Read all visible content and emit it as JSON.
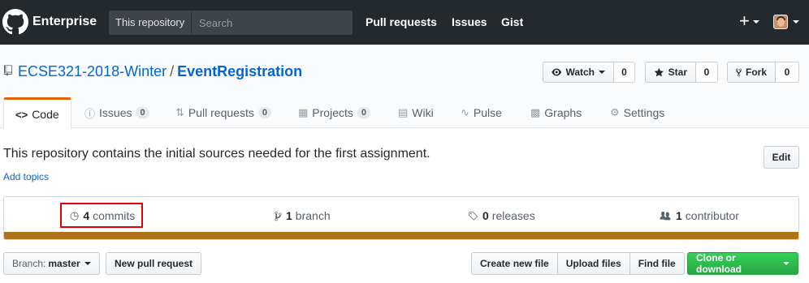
{
  "header": {
    "brand": "Enterprise",
    "search_scope": "This repository",
    "search_placeholder": "Search",
    "nav": [
      "Pull requests",
      "Issues",
      "Gist"
    ],
    "plus_label": "+"
  },
  "repo": {
    "owner": "ECSE321-2018-Winter",
    "separator": "/",
    "name": "EventRegistration",
    "watch_label": "Watch",
    "watch_count": "0",
    "star_label": "Star",
    "star_count": "0",
    "fork_label": "Fork",
    "fork_count": "0"
  },
  "tabs": [
    {
      "label": "Code",
      "icon": "code-icon"
    },
    {
      "label": "Issues",
      "counter": "0",
      "icon": "issue-icon"
    },
    {
      "label": "Pull requests",
      "counter": "0",
      "icon": "pull-request-icon"
    },
    {
      "label": "Projects",
      "counter": "0",
      "icon": "project-icon"
    },
    {
      "label": "Wiki",
      "icon": "book-icon"
    },
    {
      "label": "Pulse",
      "icon": "pulse-icon"
    },
    {
      "label": "Graphs",
      "icon": "graph-icon"
    },
    {
      "label": "Settings",
      "icon": "gear-icon"
    }
  ],
  "description": "This repository contains the initial sources needed for the first assignment.",
  "add_topics": "Add topics",
  "edit_label": "Edit",
  "summary": {
    "commits_count": "4",
    "commits_label": "commits",
    "branch_count": "1",
    "branch_label": "branch",
    "releases_count": "0",
    "releases_label": "releases",
    "contributors_count": "1",
    "contributors_label": "contributor"
  },
  "language_bar_color": "#b07219",
  "file_nav": {
    "branch_label": "Branch:",
    "branch_value": "master",
    "new_pull_request": "New pull request",
    "create_file": "Create new file",
    "upload_files": "Upload files",
    "find_file": "Find file",
    "clone_download": "Clone or download"
  }
}
